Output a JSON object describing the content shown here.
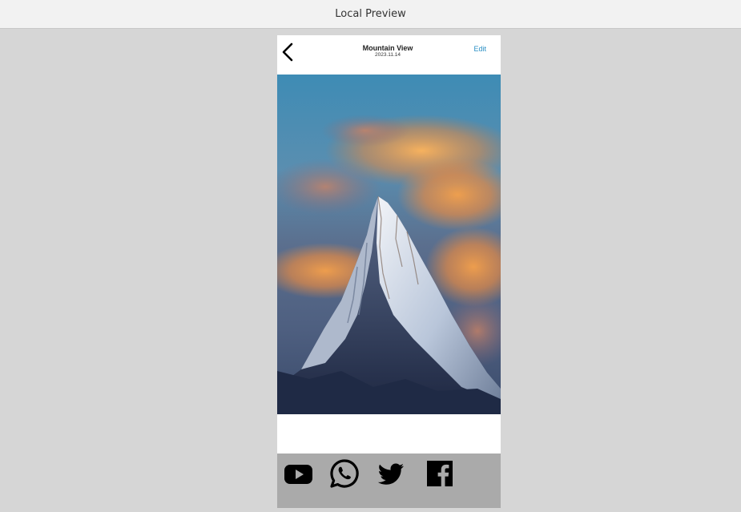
{
  "window": {
    "title": "Local Preview"
  },
  "nav": {
    "back_icon": "chevron-left-icon",
    "title": "Mountain View",
    "subtitle": "2023.11.14",
    "edit_label": "Edit",
    "edit_color": "#2a8fc4"
  },
  "photo": {
    "subject": "snow-capped mountain peak with orange clouds"
  },
  "share": {
    "background": "#aaaaaa",
    "icons": [
      "youtube-icon",
      "whatsapp-icon",
      "twitter-icon",
      "facebook-icon"
    ]
  }
}
